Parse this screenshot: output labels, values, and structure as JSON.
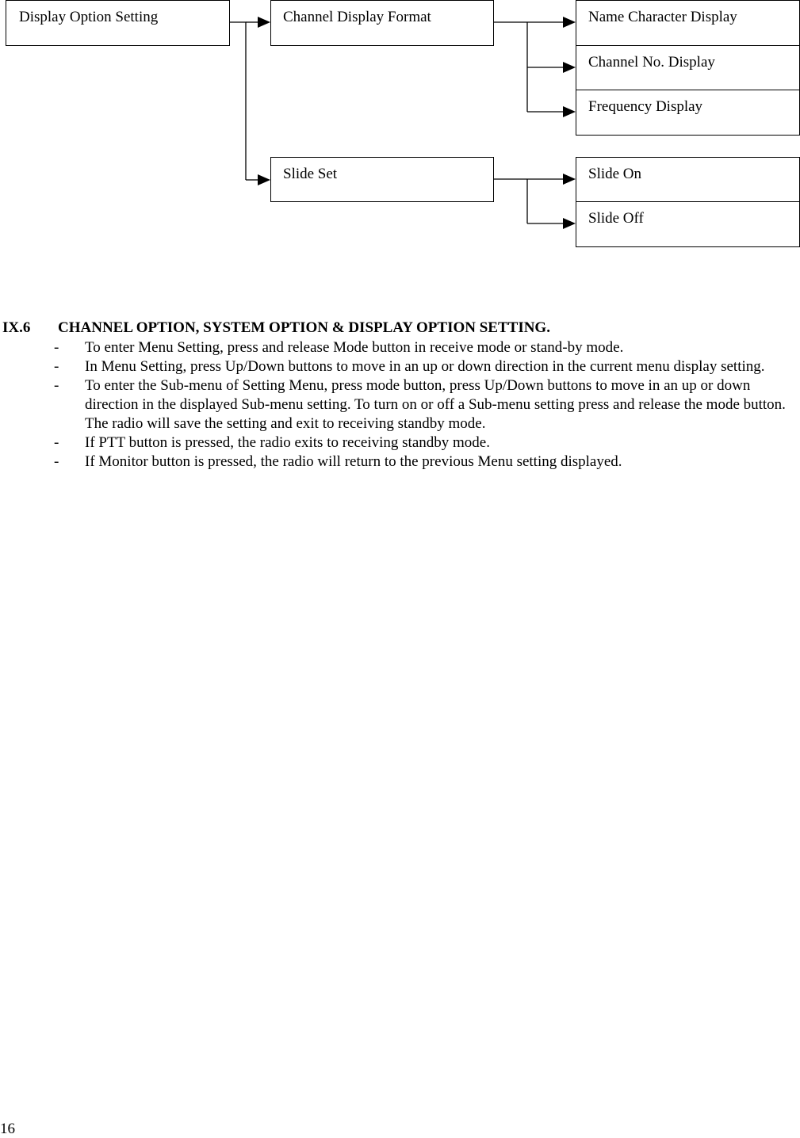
{
  "diagram": {
    "root": {
      "label": "Display Option Setting"
    },
    "level1": [
      {
        "label": "Channel Display Format",
        "children": [
          {
            "label": "Name Character Display"
          },
          {
            "label": "Channel No. Display"
          },
          {
            "label": "Frequency Display"
          }
        ]
      },
      {
        "label": "Slide Set",
        "children": [
          {
            "label": "Slide On"
          },
          {
            "label": "Slide Off"
          }
        ]
      }
    ]
  },
  "section": {
    "number": "IX.6",
    "title": "CHANNEL OPTION, SYSTEM OPTION & DISPLAY OPTION SETTING.",
    "bullet": "-",
    "items": [
      "To enter Menu Setting, press and release Mode button in receive mode or stand-by mode.",
      "In Menu Setting, press Up/Down buttons to move in an up or down direction in the current menu display setting.",
      "To enter the Sub-menu of Setting Menu, press mode button, press Up/Down buttons to move in an up or down direction in the displayed Sub-menu setting. To turn on or off a Sub-menu setting press and release the mode button. The radio will save the setting and exit to receiving standby mode.",
      "If PTT button is pressed, the radio exits to receiving standby mode.",
      "If Monitor button is pressed, the radio will return to the previous Menu setting displayed."
    ]
  },
  "page_number": "16"
}
